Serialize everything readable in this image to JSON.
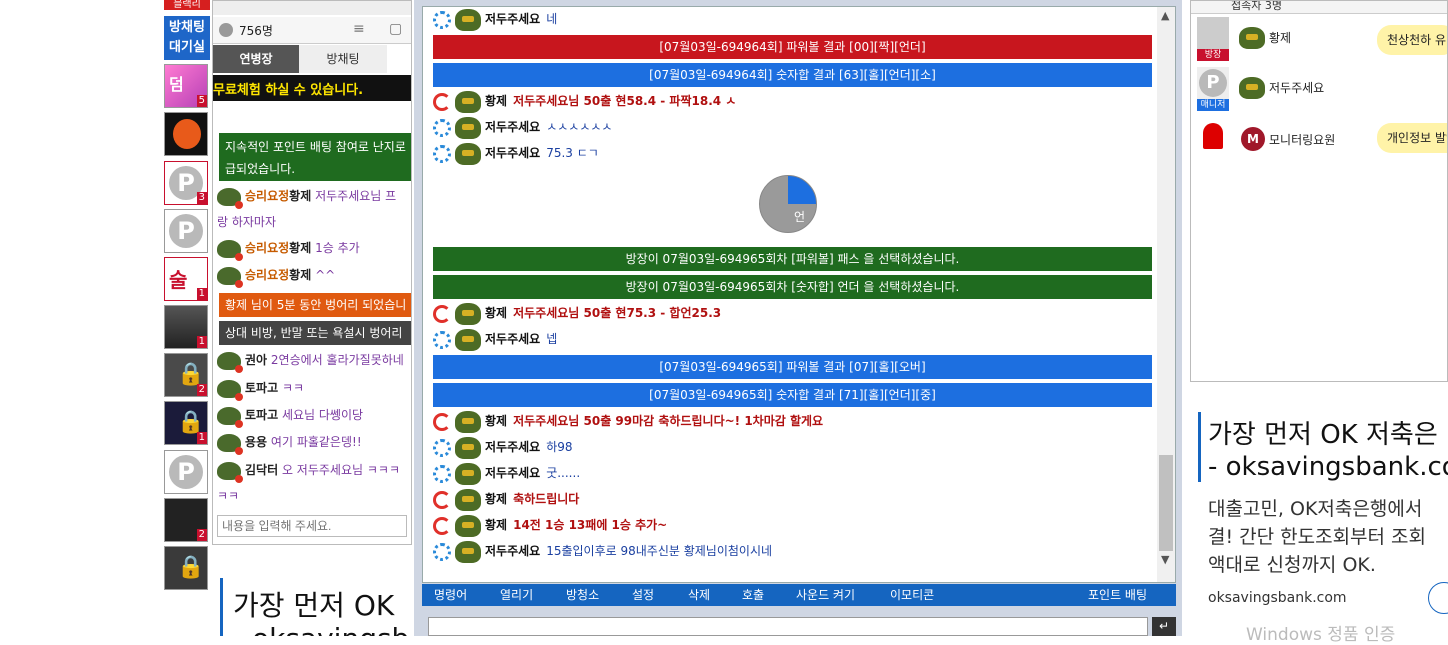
{
  "left_column": {
    "top_label": "블랙리",
    "bangchat_label": "방채팅\n대기실",
    "badges": [
      "5",
      "",
      "3",
      "",
      "1",
      "1",
      "2",
      "1",
      "",
      "2",
      ""
    ]
  },
  "side_chat": {
    "users_count": "756명",
    "tabs": [
      "연병장",
      "방채팅"
    ],
    "banner": "무료체험 하실 수 있습니다.",
    "notice": "지속적인 포인트 배팅 참여로 난지로 급되었습니다.",
    "messages": [
      {
        "rank": "승리요정",
        "nick": "황제",
        "text": "저두주세요님 프"
      },
      {
        "rank": "",
        "nick": "",
        "text": "랑 하자마자"
      },
      {
        "rank": "승리요정",
        "nick": "황제",
        "text": "1승 추가"
      },
      {
        "rank": "승리요정",
        "nick": "황제",
        "text": "^^"
      },
      {
        "rank": "",
        "nick": "권아",
        "text": "2연승에서 홀라가질못하네"
      },
      {
        "rank": "",
        "nick": "토파고",
        "text": "ㅋㅋ"
      },
      {
        "rank": "",
        "nick": "토파고",
        "text": "세요님 다쎙이당"
      },
      {
        "rank": "",
        "nick": "용용",
        "text": "여기 파홀같은뎅!!"
      },
      {
        "rank": "",
        "nick": "김닥터",
        "text": "오 저두주세요님 ㅋㅋㅋ"
      },
      {
        "rank": "",
        "nick": "",
        "text": "ㅋㅋ"
      }
    ],
    "sys_ban": "황제 님이 5분 동안 벙어리 되었습니",
    "sys_warn": "상대 비방, 반말 또는 욕설시 벙어리",
    "input_placeholder": "내용을 입력해 주세요."
  },
  "main_chat": {
    "rows": [
      {
        "type": "msg",
        "icon": "blue",
        "nick": "저두주세요",
        "text": "네",
        "color": "#1a3fa0"
      },
      {
        "type": "bar",
        "bg": "#c8161e",
        "text": "[07월03일-694964회] 파워볼 결과 [00][짝][언더]"
      },
      {
        "type": "bar",
        "bg": "#1d6fe0",
        "text": "[07월03일-694964회] 숫자합 결과 [63][홀][언더][소]"
      },
      {
        "type": "msg",
        "icon": "red",
        "nick": "황제",
        "text": "저두주세요님 50출 현58.4 - 파짝18.4 ㅅ",
        "color": "#b01010"
      },
      {
        "type": "msg",
        "icon": "blue",
        "nick": "저두주세요",
        "text": "ㅅㅅㅅㅅㅅㅅ",
        "color": "#1a3fa0"
      },
      {
        "type": "msg",
        "icon": "blue",
        "nick": "저두주세요",
        "text": "75.3 ㄷㄱ",
        "color": "#1a3fa0"
      },
      {
        "type": "pie",
        "label": "언"
      },
      {
        "type": "bar",
        "bg": "#1f6b1f",
        "text": "방장이 07월03일-694965회차 [파워볼] 패스 을 선택하셨습니다."
      },
      {
        "type": "bar",
        "bg": "#1f6b1f",
        "text": "방장이 07월03일-694965회차 [숫자합] 언더 을 선택하셨습니다."
      },
      {
        "type": "msg",
        "icon": "red",
        "nick": "황제",
        "text": "저두주세요님 50출 현75.3 - 합언25.3",
        "color": "#b01010"
      },
      {
        "type": "msg",
        "icon": "blue",
        "nick": "저두주세요",
        "text": "넵",
        "color": "#1a3fa0"
      },
      {
        "type": "bar",
        "bg": "#1d6fe0",
        "text": "[07월03일-694965회] 파워볼 결과 [07][홀][오버]"
      },
      {
        "type": "bar",
        "bg": "#1d6fe0",
        "text": "[07월03일-694965회] 숫자합 결과 [71][홀][언더][중]"
      },
      {
        "type": "msg",
        "icon": "red",
        "nick": "황제",
        "text": "저두주세요님 50출 99마감 축하드립니다~! 1차마감 할게요",
        "color": "#b01010"
      },
      {
        "type": "msg",
        "icon": "blue",
        "nick": "저두주세요",
        "text": "하98",
        "color": "#1a3fa0"
      },
      {
        "type": "msg",
        "icon": "blue",
        "nick": "저두주세요",
        "text": "굿......",
        "color": "#1a3fa0"
      },
      {
        "type": "msg",
        "icon": "red",
        "nick": "황제",
        "text": "축하드립니다",
        "color": "#b01010"
      },
      {
        "type": "msg",
        "icon": "red",
        "nick": "황제",
        "text": "14전 1승 13패에 1승 추가~",
        "color": "#b01010"
      },
      {
        "type": "msg",
        "icon": "blue",
        "nick": "저두주세요",
        "text": "15출입이후로 98내주신분 황제님이첨이시네",
        "color": "#1a3fa0"
      }
    ],
    "toolbar": [
      "명령어",
      "열리기",
      "방청소",
      "설정",
      "삭제",
      "호출",
      "사운드 켜기",
      "이모티콘",
      "포인트 배팅"
    ]
  },
  "right_panel": {
    "header": "접속자 3명",
    "users": [
      {
        "tag": "방장",
        "name": "황제",
        "speech": "천상천하 유"
      },
      {
        "tag": "매니저",
        "name": "저두주세요",
        "speech": ""
      },
      {
        "tag": "",
        "name": "모니터링요원",
        "speech": "개인정보 발언"
      }
    ]
  },
  "ad": {
    "headline1": "가장 먼저 OK 저축은",
    "headline2": "- oksavingsbank.co",
    "body1": "대출고민, OK저축은행에서",
    "body2": "결! 간단 한도조회부터 조회",
    "body3": "액대로 신청까지 OK.",
    "url": "oksavingsbank.com",
    "windows": "Windows 정품 인증"
  },
  "bottom_ad": {
    "headline": "가장 먼저 OK",
    "sub": "- oksavingsb"
  }
}
